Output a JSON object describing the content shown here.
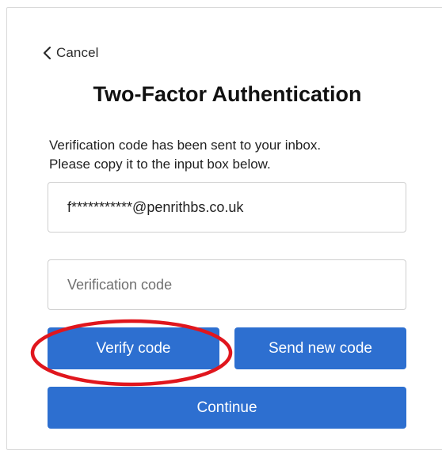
{
  "nav": {
    "cancel_label": "Cancel"
  },
  "header": {
    "title": "Two-Factor Authentication"
  },
  "intro": {
    "line1": "Verification code has been sent to your inbox.",
    "line2": "Please copy it to the input box below."
  },
  "form": {
    "email_value": "f***********@penrithbs.co.uk",
    "code_placeholder": "Verification code",
    "code_value": ""
  },
  "buttons": {
    "verify_label": "Verify code",
    "resend_label": "Send new code",
    "continue_label": "Continue"
  },
  "colors": {
    "button_bg": "#2d6fd0",
    "annotation_ring": "#e0161d"
  },
  "icons": {
    "back": "chevron-left-icon"
  }
}
